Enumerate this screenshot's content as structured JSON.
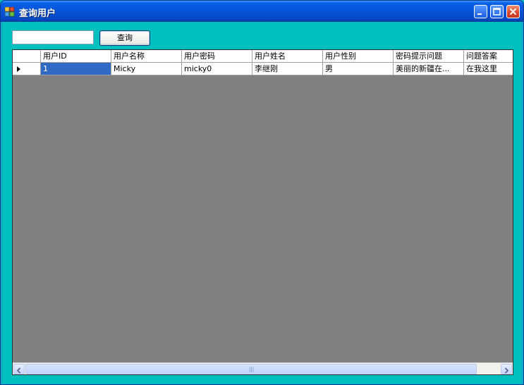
{
  "window": {
    "title": "查询用户"
  },
  "toolbar": {
    "search_value": "",
    "query_label": "查询"
  },
  "grid": {
    "columns": [
      "用户ID",
      "用户名称",
      "用户密码",
      "用户姓名",
      "用户性别",
      "密码提示问题",
      "问题答案"
    ],
    "rows": [
      [
        "1",
        "Micky",
        "micky0",
        "李继刚",
        "男",
        "美丽的新疆在...",
        "在我这里"
      ]
    ]
  },
  "scrollbar": {
    "grip": "|||"
  },
  "colors": {
    "title_bar": "#0754d7",
    "client_bg": "#00bfbf",
    "grid_bg": "#808080",
    "selection": "#316ac5"
  }
}
